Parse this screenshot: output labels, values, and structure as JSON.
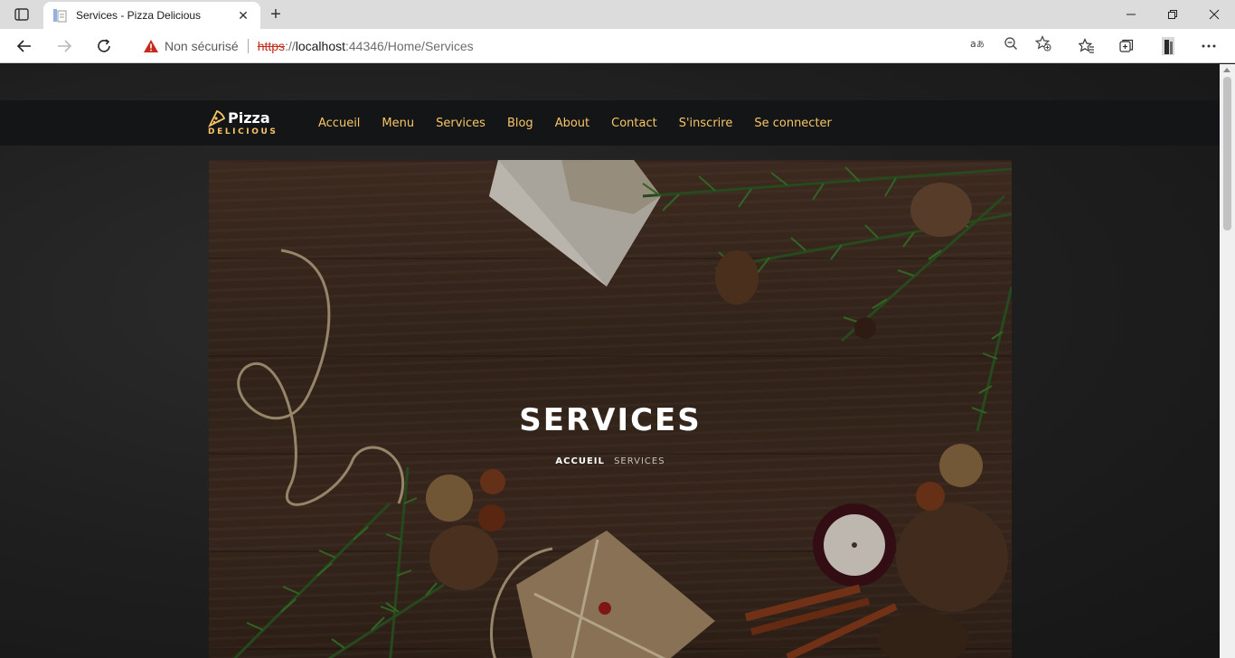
{
  "browser": {
    "tab_title": "Services - Pizza Delicious",
    "new_tab_symbol": "+",
    "security_label": "Non sécurisé",
    "url_scheme": "https",
    "url_sep": "://",
    "url_host": "localhost",
    "url_rest": ":44346/Home/Services"
  },
  "site": {
    "logo_word": "Pizza",
    "logo_sub": "DELICIOUS",
    "nav_items": [
      {
        "label": "Accueil"
      },
      {
        "label": "Menu"
      },
      {
        "label": "Services"
      },
      {
        "label": "Blog"
      },
      {
        "label": "About"
      },
      {
        "label": "Contact"
      },
      {
        "label": "S'inscrire"
      },
      {
        "label": "Se connecter"
      }
    ],
    "accent_color": "#fac564"
  },
  "hero": {
    "title": "SERVICES",
    "breadcrumb_home": "ACCUEIL",
    "breadcrumb_current": "SERVICES"
  },
  "icons": [
    "tab-actions-icon",
    "favicon-icon",
    "close-icon",
    "minimize-icon",
    "restore-icon",
    "back-icon",
    "forward-icon",
    "refresh-icon",
    "warning-icon",
    "read-aloud-icon",
    "zoom-icon",
    "add-favorite-icon",
    "favorites-icon",
    "collections-icon",
    "profile-icon",
    "more-icon",
    "pizza-slice-icon"
  ]
}
